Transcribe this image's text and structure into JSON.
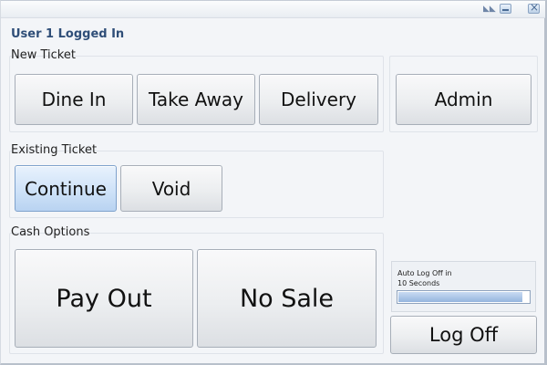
{
  "header": {
    "user_status": "User 1 Logged In"
  },
  "new_ticket": {
    "label": "New Ticket",
    "buttons": [
      "Dine In",
      "Take Away",
      "Delivery"
    ]
  },
  "admin": {
    "label": "Admin"
  },
  "existing_ticket": {
    "label": "Existing Ticket",
    "continue_label": "Continue",
    "void_label": "Void"
  },
  "cash_options": {
    "label": "Cash Options",
    "pay_out_label": "Pay Out",
    "no_sale_label": "No Sale"
  },
  "auto_logoff": {
    "line1": "Auto Log Off in",
    "line2": "10 Seconds",
    "progress_fraction": 0.95
  },
  "log_off": {
    "label": "Log Off"
  },
  "titlebar": {
    "icons": [
      "resize-grip-icon",
      "minimize-icon",
      "close-icon"
    ]
  }
}
